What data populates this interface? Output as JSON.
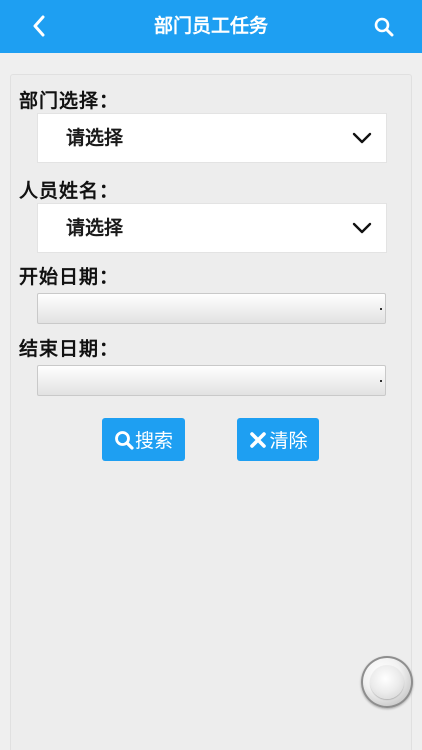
{
  "header": {
    "title": "部门员工任务",
    "back_icon": "chevron-left-icon",
    "search_icon": "search-icon",
    "bg_color": "#1e9ff2"
  },
  "form": {
    "department": {
      "label": "部门选择：",
      "value": "请选择"
    },
    "person": {
      "label": "人员姓名：",
      "value": "请选择"
    },
    "start_date": {
      "label": "开始日期：",
      "value": ""
    },
    "end_date": {
      "label": "结束日期：",
      "value": ""
    }
  },
  "buttons": {
    "search": {
      "label": "搜索",
      "icon": "search-icon"
    },
    "clear": {
      "label": "清除",
      "icon": "close-icon"
    }
  },
  "colors": {
    "accent": "#1e9ff2",
    "background": "#efefef"
  }
}
